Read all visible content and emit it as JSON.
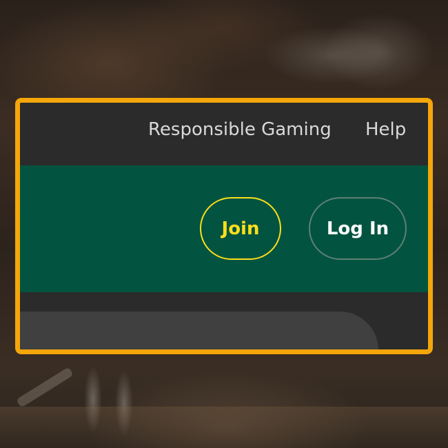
{
  "utility_nav": {
    "responsible_gaming": "Responsible Gaming",
    "help": "Help"
  },
  "header": {
    "join_label": "Join",
    "login_label": "Log In"
  },
  "colors": {
    "highlight_border": "#f5a60a",
    "header_green": "#025440",
    "utility_bar": "#2b2b2b",
    "join_accent": "#ffdf1b"
  }
}
